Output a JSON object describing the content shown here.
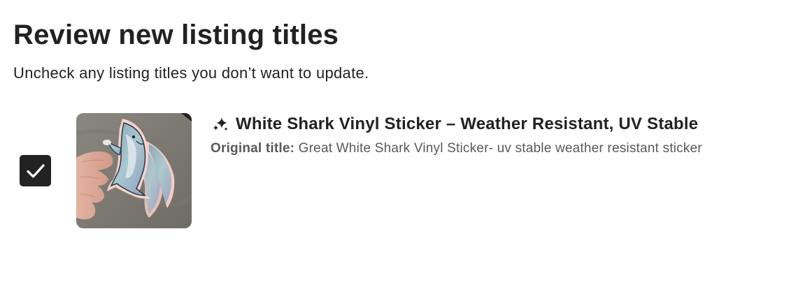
{
  "header": {
    "title": "Review new listing titles",
    "subtitle": "Uncheck any listing titles you don’t want to update."
  },
  "listings": [
    {
      "checked": true,
      "new_title": "White Shark Vinyl Sticker – Weather Resistant, UV Stable",
      "original_label": "Original title:",
      "original_title": "Great White Shark Vinyl Sticker- uv stable weather resistant sticker",
      "new_title_icon": "sparkle-icon",
      "thumbnail": "listing-thumbnail"
    }
  ],
  "colors": {
    "text_primary": "#222222",
    "text_secondary": "#595959",
    "checkbox_fill": "#222222",
    "background": "#ffffff"
  }
}
